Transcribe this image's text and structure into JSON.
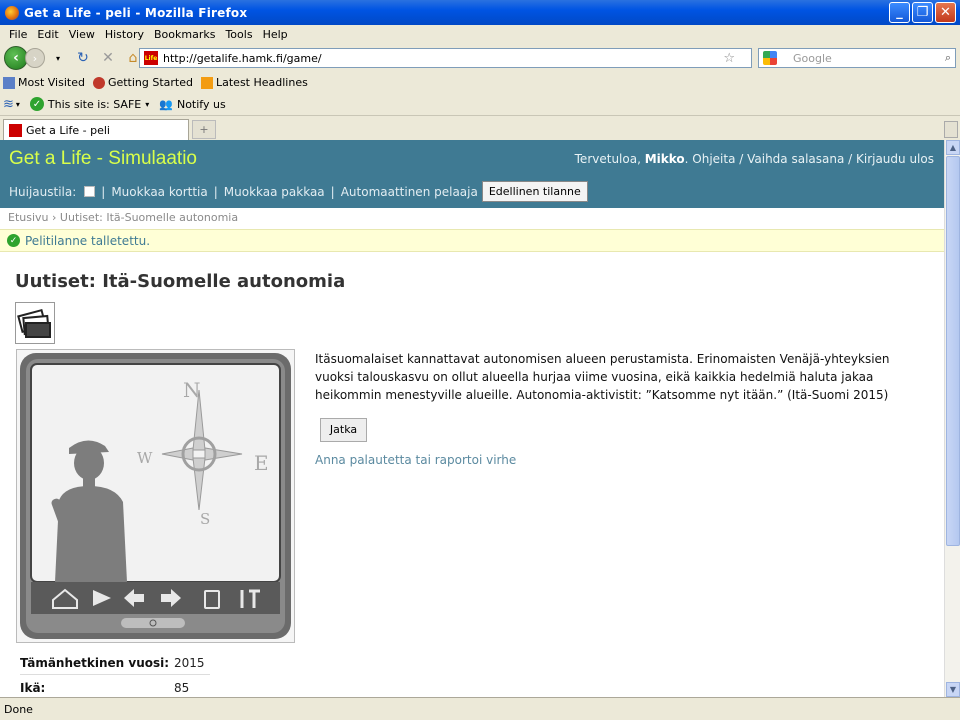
{
  "window": {
    "title": "Get a Life - peli - Mozilla Firefox"
  },
  "menu": [
    "File",
    "Edit",
    "View",
    "History",
    "Bookmarks",
    "Tools",
    "Help"
  ],
  "nav": {
    "url": "http://getalife.hamk.fi/game/",
    "search_placeholder": "Google"
  },
  "bookmarks": [
    "Most Visited",
    "Getting Started",
    "Latest Headlines"
  ],
  "addons": {
    "safe_text": "This site is: SAFE",
    "notify_text": "Notify us"
  },
  "tab": {
    "title": "Get a Life - peli",
    "new_tab_label": "+"
  },
  "site": {
    "brand": "Get a Life - Simulaatio",
    "welcome_prefix": "Tervetuloa, ",
    "user": "Mikko",
    "user_links": ". Ohjeita / Vaihda salasana / Kirjaudu ulos",
    "cheat_label": "Huijaustila:",
    "tools": [
      "Muokkaa korttia",
      "Muokkaa pakkaa",
      "Automaattinen pelaaja"
    ],
    "prev_button": "Edellinen tilanne"
  },
  "breadcrumb": {
    "home": "Etusivu",
    "current": "Uutiset: Itä-Suomelle autonomia"
  },
  "notice": "Pelitilanne talletettu.",
  "article": {
    "title": "Uutiset: Itä-Suomelle autonomia",
    "body": "Itäsuomalaiset kannattavat autonomisen alueen perustamista. Erinomaisten Venäjä-yhteyksien vuoksi talouskasvu on ollut alueella hurjaa viime vuosina, eikä kaikkia hedelmiä haluta jakaa heikommin menestyville alueille. Autonomia-aktivistit: ”Katsomme nyt itään.” (Itä-Suomi 2015)",
    "continue_button": "Jatka",
    "feedback_link": "Anna palautetta tai raportoi virhe"
  },
  "compass": {
    "n": "N",
    "e": "E",
    "s": "S",
    "w": "W"
  },
  "stats": [
    {
      "label": "Tämänhetkinen vuosi:",
      "value": "2015"
    },
    {
      "label": "Ikä:",
      "value": "85"
    }
  ],
  "status": "Done"
}
